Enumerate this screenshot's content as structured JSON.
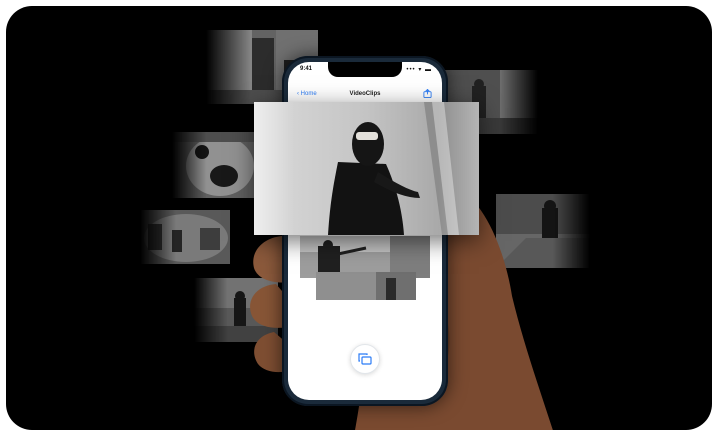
{
  "status_bar": {
    "time": "9:41",
    "icons": "••• ▾ ▬"
  },
  "nav": {
    "back_label": "‹ Home",
    "title": "VideoClips",
    "share_icon": "share-icon"
  },
  "toolbar": {
    "multi_view_icon": "multi-view-icon"
  },
  "colors": {
    "background": "#000000",
    "accent": "#2b7cf6",
    "phone_frame": "#1a2a3a"
  }
}
